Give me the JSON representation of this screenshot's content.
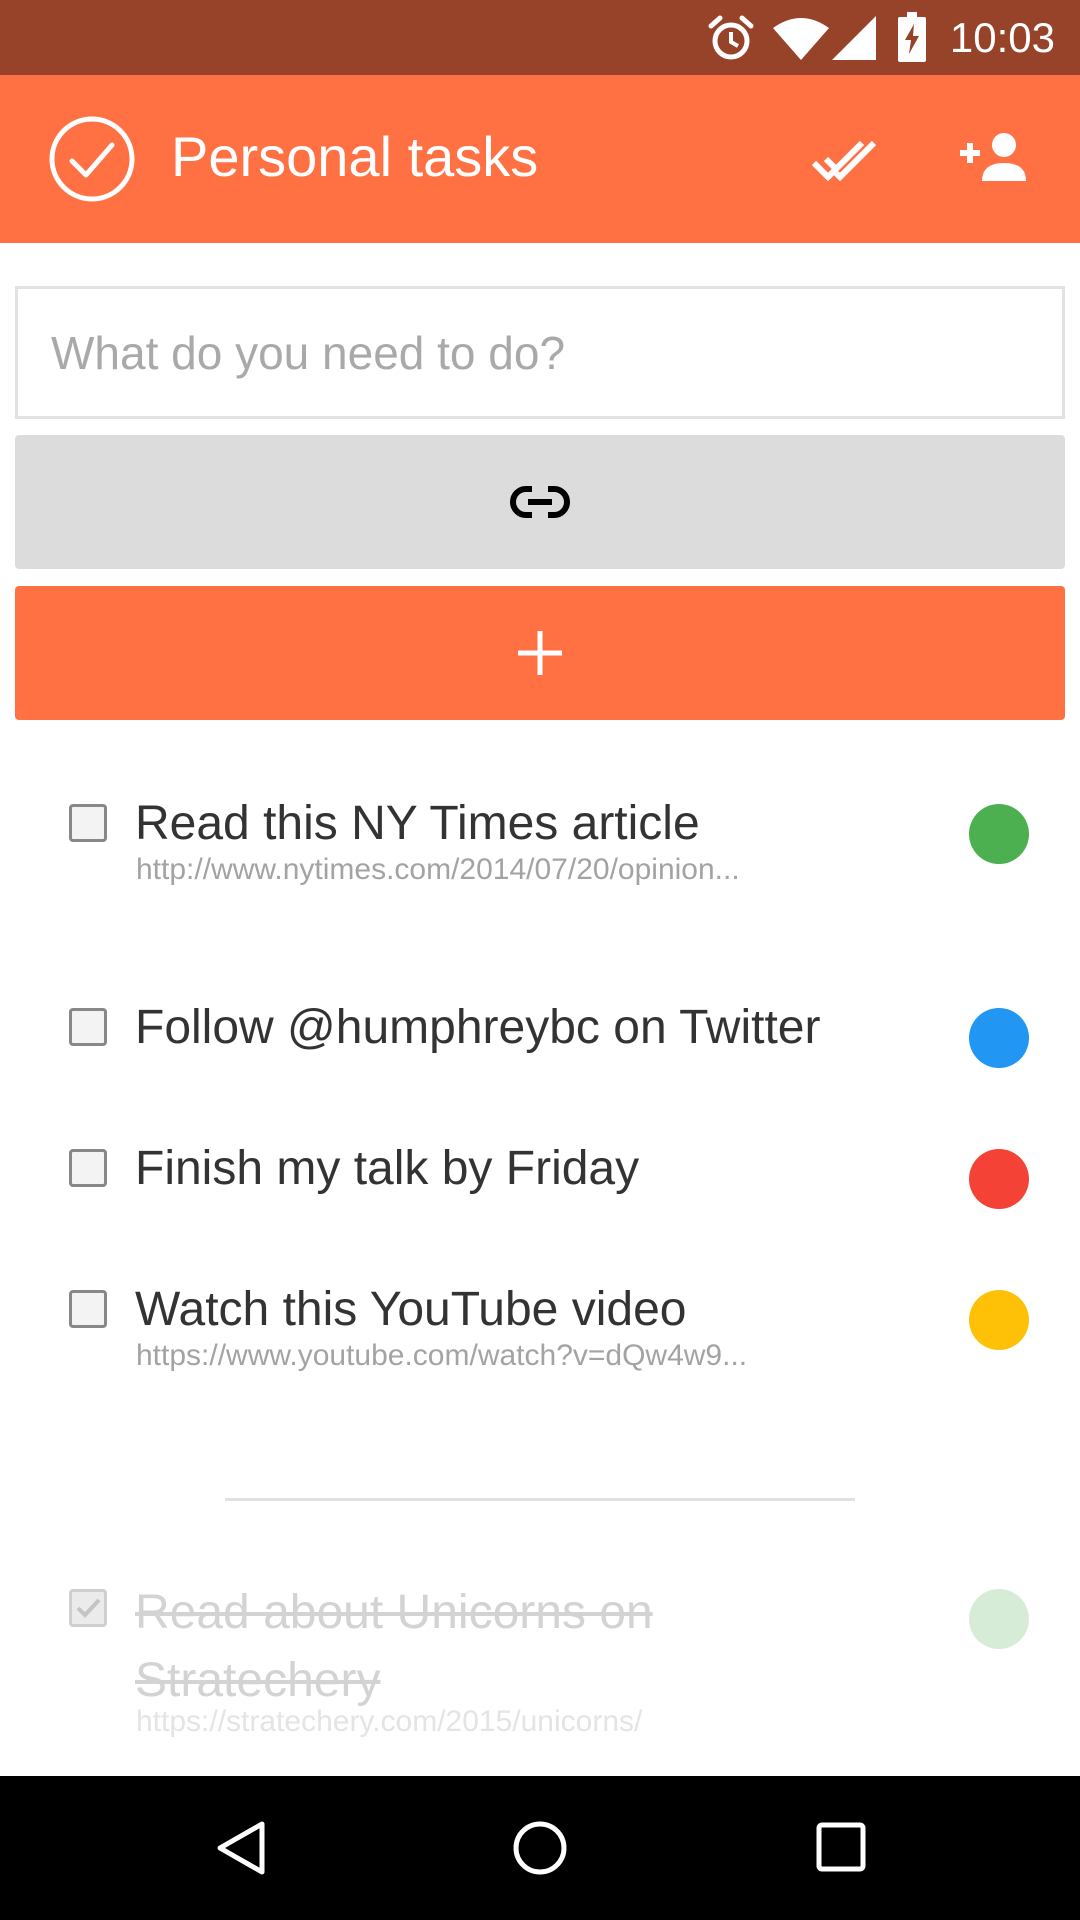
{
  "status_bar": {
    "time": "10:03",
    "icons": [
      "alarm-icon",
      "wifi-icon",
      "signal-icon",
      "battery-charging-icon"
    ],
    "background": "#96432a"
  },
  "app_bar": {
    "title": "Personal tasks",
    "logo_icon": "check-circle-icon",
    "actions": [
      "done-all-icon",
      "add-person-icon"
    ],
    "background": "#ff7043"
  },
  "new_task": {
    "placeholder": "What do you need to do?",
    "value": "",
    "link_button_icon": "link-icon",
    "add_button_icon": "plus-icon"
  },
  "tasks": [
    {
      "title": "Read this NY Times article",
      "url": "http://www.nytimes.com/2014/07/20/opinion...",
      "color": "#4caf50",
      "done": false
    },
    {
      "title": "Follow @humphreybc on Twitter",
      "url": "",
      "color": "#2196f3",
      "done": false
    },
    {
      "title": "Finish my talk by Friday",
      "url": "",
      "color": "#f44336",
      "done": false
    },
    {
      "title": "Watch this YouTube video",
      "url": "https://www.youtube.com/watch?v=dQw4w9...",
      "color": "#ffc107",
      "done": false
    }
  ],
  "completed_tasks": [
    {
      "title": "Read about Unicorns on Stratechery",
      "url": "https://stratechery.com/2015/unicorns/",
      "color": "#d7ecd7",
      "done": true
    }
  ],
  "nav_bar": {
    "buttons": [
      "back-icon",
      "home-icon",
      "recents-icon"
    ]
  }
}
